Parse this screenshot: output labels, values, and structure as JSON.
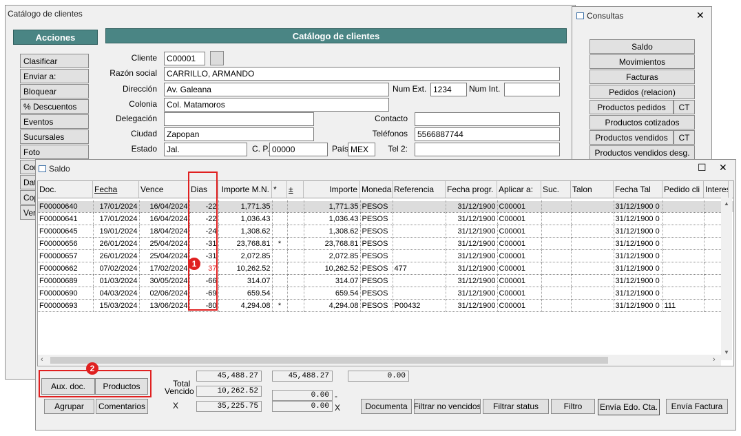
{
  "catalog": {
    "window_title": "Catálogo de clientes",
    "acciones_header": "Acciones",
    "panel_header": "Catálogo de clientes",
    "actions": [
      "Clasificar",
      "Enviar a:",
      "Bloquear",
      "% Descuentos",
      "Eventos",
      "Sucursales",
      "Foto",
      "Con",
      "Dat",
      "Cop",
      "Ver"
    ],
    "labels": {
      "cliente": "Cliente",
      "razon_social": "Razón social",
      "direccion": "Dirección",
      "num_ext": "Num Ext.",
      "num_int": "Num Int.",
      "colonia": "Colonia",
      "delegacion": "Delegación",
      "contacto": "Contacto",
      "ciudad": "Ciudad",
      "telefonos": "Teléfonos",
      "estado": "Estado",
      "cp": "C. P.",
      "pais": "País",
      "tel2": "Tel 2:"
    },
    "values": {
      "cliente": "C00001",
      "razon_social": "CARRILLO, ARMANDO",
      "direccion": "Av. Galeana",
      "num_ext": "1234",
      "num_int": "",
      "colonia": "Col. Matamoros",
      "delegacion": "",
      "contacto": "",
      "ciudad": "Zapopan",
      "telefonos": "5566887744",
      "estado": "Jal.",
      "cp": "00000",
      "pais": "MEX",
      "tel2": ""
    }
  },
  "consultas": {
    "window_title": "Consultas",
    "close": "✕",
    "buttons": [
      "Saldo",
      "Movimientos",
      "Facturas",
      "Pedidos (relacion)",
      "Productos pedidos",
      "Productos cotizados",
      "Productos vendidos",
      "Productos vendidos desg."
    ],
    "ct_label": "CT"
  },
  "saldo": {
    "window_title": "Saldo",
    "maximize": "☐",
    "close": "✕",
    "columns": [
      "Doc.",
      "Fecha",
      "Vence",
      "Dias",
      "Importe M.N.",
      "*",
      "±",
      "Importe",
      "Moneda",
      "Referencia",
      "Fecha progr.",
      "Aplicar a:",
      "Suc.",
      "Talon",
      "Fecha Tal",
      "Pedido cli",
      "Interes"
    ],
    "rows": [
      {
        "doc": "F00000640",
        "fecha": "17/01/2024",
        "vence": "16/04/2024",
        "dias": "-22",
        "importe_mn": "1,771.35",
        "star": "",
        "pm": "",
        "importe": "1,771.35",
        "moneda": "PESOS",
        "referencia": "",
        "fecha_progr": "31/12/1900",
        "aplicar": "C00001",
        "suc": "",
        "talon": "",
        "fecha_tal": "31/12/1900 0",
        "pedido": "",
        "interes": ""
      },
      {
        "doc": "F00000641",
        "fecha": "17/01/2024",
        "vence": "16/04/2024",
        "dias": "-22",
        "importe_mn": "1,036.43",
        "star": "",
        "pm": "",
        "importe": "1,036.43",
        "moneda": "PESOS",
        "referencia": "",
        "fecha_progr": "31/12/1900",
        "aplicar": "C00001",
        "suc": "",
        "talon": "",
        "fecha_tal": "31/12/1900 0",
        "pedido": "",
        "interes": ""
      },
      {
        "doc": "F00000645",
        "fecha": "19/01/2024",
        "vence": "18/04/2024",
        "dias": "-24",
        "importe_mn": "1,308.62",
        "star": "",
        "pm": "",
        "importe": "1,308.62",
        "moneda": "PESOS",
        "referencia": "",
        "fecha_progr": "31/12/1900",
        "aplicar": "C00001",
        "suc": "",
        "talon": "",
        "fecha_tal": "31/12/1900 0",
        "pedido": "",
        "interes": ""
      },
      {
        "doc": "F00000656",
        "fecha": "26/01/2024",
        "vence": "25/04/2024",
        "dias": "-31",
        "importe_mn": "23,768.81",
        "star": "*",
        "pm": "",
        "importe": "23,768.81",
        "moneda": "PESOS",
        "referencia": "",
        "fecha_progr": "31/12/1900",
        "aplicar": "C00001",
        "suc": "",
        "talon": "",
        "fecha_tal": "31/12/1900 0",
        "pedido": "",
        "interes": ""
      },
      {
        "doc": "F00000657",
        "fecha": "26/01/2024",
        "vence": "25/04/2024",
        "dias": "-31",
        "importe_mn": "2,072.85",
        "star": "",
        "pm": "",
        "importe": "2,072.85",
        "moneda": "PESOS",
        "referencia": "",
        "fecha_progr": "31/12/1900",
        "aplicar": "C00001",
        "suc": "",
        "talon": "",
        "fecha_tal": "31/12/1900 0",
        "pedido": "",
        "interes": ""
      },
      {
        "doc": "F00000662",
        "fecha": "07/02/2024",
        "vence": "17/02/2024",
        "dias": "37",
        "importe_mn": "10,262.52",
        "star": "",
        "pm": "",
        "importe": "10,262.52",
        "moneda": "PESOS",
        "referencia": "477",
        "fecha_progr": "31/12/1900",
        "aplicar": "C00001",
        "suc": "",
        "talon": "",
        "fecha_tal": "31/12/1900 0",
        "pedido": "",
        "interes": ""
      },
      {
        "doc": "F00000689",
        "fecha": "01/03/2024",
        "vence": "30/05/2024",
        "dias": "-66",
        "importe_mn": "314.07",
        "star": "",
        "pm": "",
        "importe": "314.07",
        "moneda": "PESOS",
        "referencia": "",
        "fecha_progr": "31/12/1900",
        "aplicar": "C00001",
        "suc": "",
        "talon": "",
        "fecha_tal": "31/12/1900 0",
        "pedido": "",
        "interes": ""
      },
      {
        "doc": "F00000690",
        "fecha": "04/03/2024",
        "vence": "02/06/2024",
        "dias": "-69",
        "importe_mn": "659.54",
        "star": "",
        "pm": "",
        "importe": "659.54",
        "moneda": "PESOS",
        "referencia": "",
        "fecha_progr": "31/12/1900",
        "aplicar": "C00001",
        "suc": "",
        "talon": "",
        "fecha_tal": "31/12/1900 0",
        "pedido": "",
        "interes": ""
      },
      {
        "doc": "F00000693",
        "fecha": "15/03/2024",
        "vence": "13/06/2024",
        "dias": "-80",
        "importe_mn": "4,294.08",
        "star": "*",
        "pm": "",
        "importe": "4,294.08",
        "moneda": "PESOS",
        "referencia": "P00432",
        "fecha_progr": "31/12/1900",
        "aplicar": "C00001",
        "suc": "",
        "talon": "",
        "fecha_tal": "31/12/1900 0",
        "pedido": "111",
        "interes": ""
      }
    ],
    "overdue_color": "#e02020",
    "totals": {
      "total_label": "Total",
      "vencido_label": "Vencido",
      "x_label": "X",
      "total_mn": "45,488.27",
      "vencido_mn": "10,262.52",
      "x_mn": "35,225.75",
      "total_importe": "45,488.27",
      "total_other": "0.00",
      "vencido_importe": "0.00",
      "x_importe": "0.00",
      "dash": "-",
      "x2_label": "X"
    },
    "buttons": {
      "aux_doc": "Aux. doc.",
      "productos": "Productos",
      "agrupar": "Agrupar",
      "comentarios": "Comentarios",
      "documenta": "Documenta",
      "filtrar_no_vencidos": "Filtrar no vencidos",
      "filtrar_status": "Filtrar status",
      "filtro": "Filtro",
      "envia_edo": "Envía Edo. Cta.",
      "envia_factura": "Envía Factura"
    },
    "badges": [
      "1",
      "2"
    ],
    "highlight_color": "#e02020"
  }
}
